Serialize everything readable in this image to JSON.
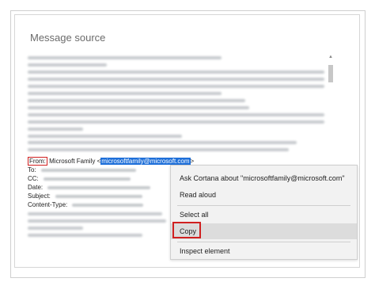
{
  "message_source": {
    "title": "Message source",
    "headers": {
      "from_label": "From:",
      "from_name": "Microsoft Family <",
      "from_email": "microsoftfamily@microsoft.com",
      "from_close": ">",
      "to_label": "To:",
      "cc_label": "CC:",
      "date_label": "Date:",
      "subject_label": "Subject:",
      "content_type_label": "Content-Type:"
    }
  },
  "context_menu": {
    "items": [
      {
        "label": "Ask Cortana about \"microsoftfamily@microsoft.com\""
      },
      {
        "label": "Read aloud"
      },
      {
        "label": "Select all"
      },
      {
        "label": "Copy"
      },
      {
        "label": "Inspect element"
      }
    ]
  },
  "colors": {
    "highlight_border": "#d02020",
    "selection": "#1e6fd9"
  }
}
